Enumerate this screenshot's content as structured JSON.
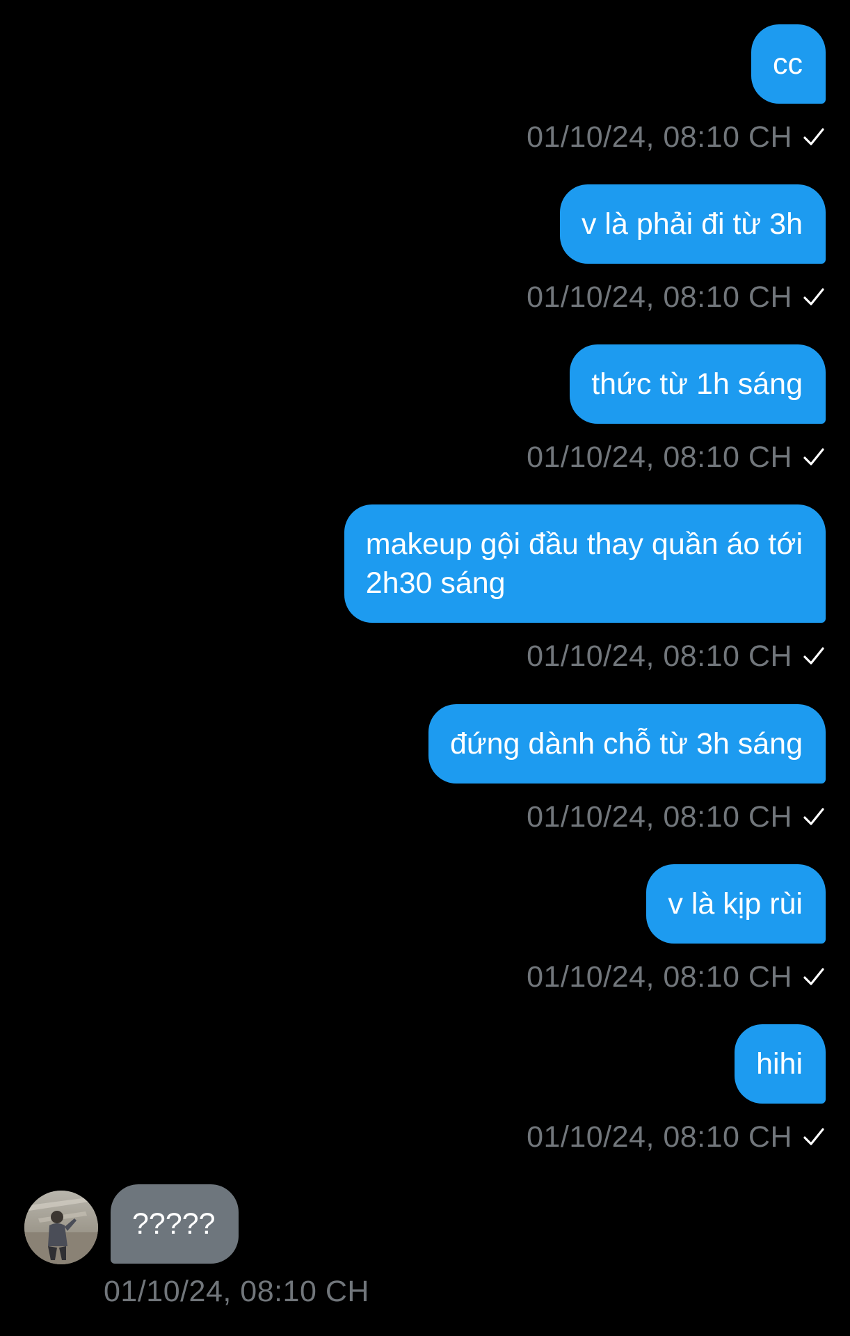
{
  "messages_outgoing": [
    {
      "text": "cc",
      "time": "01/10/24, 08:10 CH"
    },
    {
      "text": "v là phải đi từ 3h",
      "time": "01/10/24, 08:10 CH"
    },
    {
      "text": "thức từ 1h sáng",
      "time": "01/10/24, 08:10 CH"
    },
    {
      "text": "makeup gội đầu thay quần áo tới\n2h30 sáng",
      "time": "01/10/24, 08:10 CH"
    },
    {
      "text": "đứng dành chỗ từ 3h sáng",
      "time": "01/10/24, 08:10 CH"
    },
    {
      "text": "v là kịp rùi",
      "time": "01/10/24, 08:10 CH"
    },
    {
      "text": "hihi",
      "time": "01/10/24, 08:10 CH"
    }
  ],
  "message_incoming": {
    "text": "?????",
    "time": "01/10/24, 08:10 CH"
  },
  "colors": {
    "background": "#000000",
    "outgoing_bubble": "#1D9BF0",
    "incoming_bubble": "#6E767D",
    "timestamp": "#71767B"
  },
  "icons": {
    "sent_status": "checkmark-icon",
    "avatar": "user-avatar"
  }
}
